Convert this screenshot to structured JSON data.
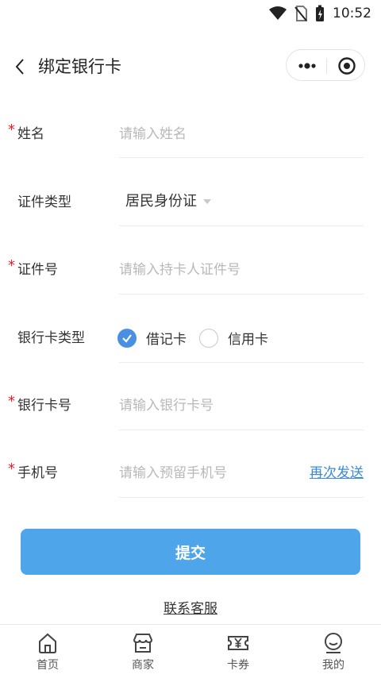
{
  "status_bar": {
    "time": "10:52"
  },
  "header": {
    "title": "绑定银行卡"
  },
  "form": {
    "name": {
      "label": "姓名",
      "placeholder": "请输入姓名"
    },
    "id_type": {
      "label": "证件类型",
      "value": "居民身份证"
    },
    "id_number": {
      "label": "证件号",
      "placeholder": "请输入持卡人证件号"
    },
    "card_type": {
      "label": "银行卡类型",
      "options": [
        "借记卡",
        "信用卡"
      ],
      "selected": "借记卡"
    },
    "card_number": {
      "label": "银行卡号",
      "placeholder": "请输入银行卡号"
    },
    "phone": {
      "label": "手机号",
      "placeholder": "请输入预留手机号",
      "resend_label": "再次发送"
    },
    "required_mark": "*"
  },
  "submit_label": "提交",
  "contact_label": "联系客服",
  "tabbar": {
    "items": [
      {
        "label": "首页",
        "icon": "home-icon"
      },
      {
        "label": "商家",
        "icon": "store-icon"
      },
      {
        "label": "卡券",
        "icon": "coupon-icon"
      },
      {
        "label": "我的",
        "icon": "profile-icon"
      }
    ]
  },
  "colors": {
    "accent": "#4ea5ea",
    "link": "#3b8ad9",
    "required": "#e0212a"
  }
}
